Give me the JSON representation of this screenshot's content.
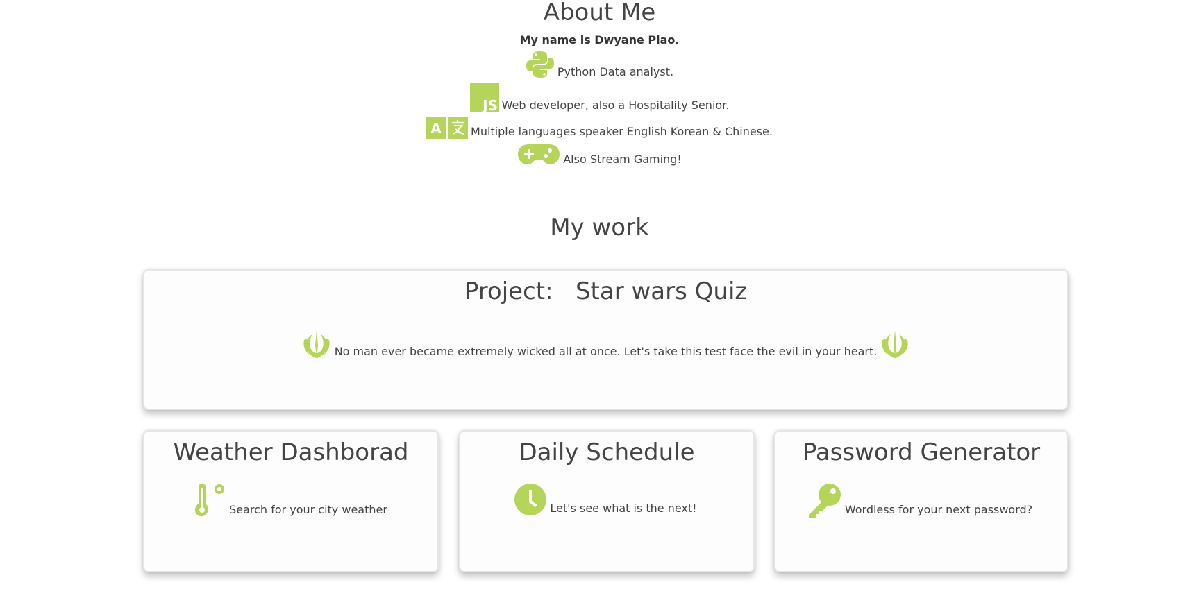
{
  "about": {
    "title": "About Me",
    "name_line": "My name is Dwyane Piao.",
    "skills": [
      {
        "icon": "python-icon",
        "text": "Python Data analyst."
      },
      {
        "icon": "javascript-icon",
        "icon_text": "JS",
        "text": "Web developer, also a Hospitality Senior."
      },
      {
        "icon": "translate-icon",
        "icon_text": "A",
        "text": "Multiple languages speaker English Korean & Chinese."
      },
      {
        "icon": "gamepad-icon",
        "text": "Also Stream Gaming!"
      }
    ]
  },
  "work": {
    "title": "My work",
    "featured": {
      "title": "Project:   Star wars Quiz",
      "description": "No man ever became extremely wicked all at once. Let's take this test face the evil in your heart.",
      "icon": "jedi-order-icon"
    },
    "projects": [
      {
        "title": "Weather Dashborad",
        "icon": "thermometer-icon",
        "text": "Search for your city weather"
      },
      {
        "title": "Daily Schedule",
        "icon": "clock-icon",
        "text": "Let's see what is the next!"
      },
      {
        "title": "Password Generator",
        "icon": "key-icon",
        "text": "Wordless for your next password?"
      }
    ]
  },
  "colors": {
    "accent": "#b5d55a",
    "text": "#444444"
  }
}
